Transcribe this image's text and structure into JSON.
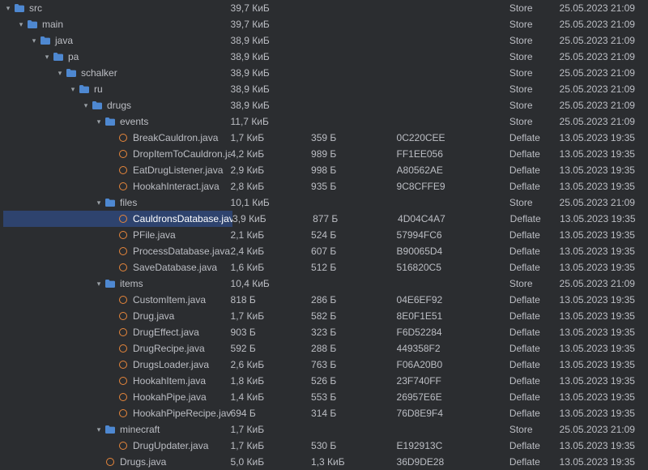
{
  "colors": {
    "background": "#2b2d30",
    "text": "#bcbec4",
    "selection": "#2e436e",
    "folder": "#4e88d1",
    "file_ring": "#e8873b"
  },
  "rows": [
    {
      "indent": 0,
      "expanded": true,
      "kind": "folder",
      "selected": false,
      "name": "src",
      "size": "39,7 КиБ",
      "packed": "",
      "crc": "",
      "method": "Store",
      "date": "25.05.2023 21:09"
    },
    {
      "indent": 1,
      "expanded": true,
      "kind": "folder",
      "selected": false,
      "name": "main",
      "size": "39,7 КиБ",
      "packed": "",
      "crc": "",
      "method": "Store",
      "date": "25.05.2023 21:09"
    },
    {
      "indent": 2,
      "expanded": true,
      "kind": "folder",
      "selected": false,
      "name": "java",
      "size": "38,9 КиБ",
      "packed": "",
      "crc": "",
      "method": "Store",
      "date": "25.05.2023 21:09"
    },
    {
      "indent": 3,
      "expanded": true,
      "kind": "folder",
      "selected": false,
      "name": "pa",
      "size": "38,9 КиБ",
      "packed": "",
      "crc": "",
      "method": "Store",
      "date": "25.05.2023 21:09"
    },
    {
      "indent": 4,
      "expanded": true,
      "kind": "folder",
      "selected": false,
      "name": "schalker",
      "size": "38,9 КиБ",
      "packed": "",
      "crc": "",
      "method": "Store",
      "date": "25.05.2023 21:09"
    },
    {
      "indent": 5,
      "expanded": true,
      "kind": "folder",
      "selected": false,
      "name": "ru",
      "size": "38,9 КиБ",
      "packed": "",
      "crc": "",
      "method": "Store",
      "date": "25.05.2023 21:09"
    },
    {
      "indent": 6,
      "expanded": true,
      "kind": "folder",
      "selected": false,
      "name": "drugs",
      "size": "38,9 КиБ",
      "packed": "",
      "crc": "",
      "method": "Store",
      "date": "25.05.2023 21:09"
    },
    {
      "indent": 7,
      "expanded": true,
      "kind": "folder",
      "selected": false,
      "name": "events",
      "size": "11,7 КиБ",
      "packed": "",
      "crc": "",
      "method": "Store",
      "date": "25.05.2023 21:09"
    },
    {
      "indent": 8,
      "expanded": null,
      "kind": "file",
      "selected": false,
      "name": "BreakCauldron.java",
      "size": "1,7 КиБ",
      "packed": "359 Б",
      "crc": "0C220CEE",
      "method": "Deflate",
      "date": "13.05.2023 19:35"
    },
    {
      "indent": 8,
      "expanded": null,
      "kind": "file",
      "selected": false,
      "name": "DropItemToCauldron.java",
      "size": "4,2 КиБ",
      "packed": "989 Б",
      "crc": "FF1EE056",
      "method": "Deflate",
      "date": "13.05.2023 19:35"
    },
    {
      "indent": 8,
      "expanded": null,
      "kind": "file",
      "selected": false,
      "name": "EatDrugListener.java",
      "size": "2,9 КиБ",
      "packed": "998 Б",
      "crc": "A80562AE",
      "method": "Deflate",
      "date": "13.05.2023 19:35"
    },
    {
      "indent": 8,
      "expanded": null,
      "kind": "file",
      "selected": false,
      "name": "HookahInteract.java",
      "size": "2,8 КиБ",
      "packed": "935 Б",
      "crc": "9C8CFFE9",
      "method": "Deflate",
      "date": "13.05.2023 19:35"
    },
    {
      "indent": 7,
      "expanded": true,
      "kind": "folder",
      "selected": false,
      "name": "files",
      "size": "10,1 КиБ",
      "packed": "",
      "crc": "",
      "method": "Store",
      "date": "25.05.2023 21:09"
    },
    {
      "indent": 8,
      "expanded": null,
      "kind": "file",
      "selected": true,
      "name": "CauldronsDatabase.java",
      "size": "3,9 КиБ",
      "packed": "877 Б",
      "crc": "4D04C4A7",
      "method": "Deflate",
      "date": "13.05.2023 19:35"
    },
    {
      "indent": 8,
      "expanded": null,
      "kind": "file",
      "selected": false,
      "name": "PFile.java",
      "size": "2,1 КиБ",
      "packed": "524 Б",
      "crc": "57994FC6",
      "method": "Deflate",
      "date": "13.05.2023 19:35"
    },
    {
      "indent": 8,
      "expanded": null,
      "kind": "file",
      "selected": false,
      "name": "ProcessDatabase.java",
      "size": "2,4 КиБ",
      "packed": "607 Б",
      "crc": "B90065D4",
      "method": "Deflate",
      "date": "13.05.2023 19:35"
    },
    {
      "indent": 8,
      "expanded": null,
      "kind": "file",
      "selected": false,
      "name": "SaveDatabase.java",
      "size": "1,6 КиБ",
      "packed": "512 Б",
      "crc": "516820C5",
      "method": "Deflate",
      "date": "13.05.2023 19:35"
    },
    {
      "indent": 7,
      "expanded": true,
      "kind": "folder",
      "selected": false,
      "name": "items",
      "size": "10,4 КиБ",
      "packed": "",
      "crc": "",
      "method": "Store",
      "date": "25.05.2023 21:09"
    },
    {
      "indent": 8,
      "expanded": null,
      "kind": "file",
      "selected": false,
      "name": "CustomItem.java",
      "size": "818 Б",
      "packed": "286 Б",
      "crc": "04E6EF92",
      "method": "Deflate",
      "date": "13.05.2023 19:35"
    },
    {
      "indent": 8,
      "expanded": null,
      "kind": "file",
      "selected": false,
      "name": "Drug.java",
      "size": "1,7 КиБ",
      "packed": "582 Б",
      "crc": "8E0F1E51",
      "method": "Deflate",
      "date": "13.05.2023 19:35"
    },
    {
      "indent": 8,
      "expanded": null,
      "kind": "file",
      "selected": false,
      "name": "DrugEffect.java",
      "size": "903 Б",
      "packed": "323 Б",
      "crc": "F6D52284",
      "method": "Deflate",
      "date": "13.05.2023 19:35"
    },
    {
      "indent": 8,
      "expanded": null,
      "kind": "file",
      "selected": false,
      "name": "DrugRecipe.java",
      "size": "592 Б",
      "packed": "288 Б",
      "crc": "449358F2",
      "method": "Deflate",
      "date": "13.05.2023 19:35"
    },
    {
      "indent": 8,
      "expanded": null,
      "kind": "file",
      "selected": false,
      "name": "DrugsLoader.java",
      "size": "2,6 КиБ",
      "packed": "763 Б",
      "crc": "F06A20B0",
      "method": "Deflate",
      "date": "13.05.2023 19:35"
    },
    {
      "indent": 8,
      "expanded": null,
      "kind": "file",
      "selected": false,
      "name": "HookahItem.java",
      "size": "1,8 КиБ",
      "packed": "526 Б",
      "crc": "23F740FF",
      "method": "Deflate",
      "date": "13.05.2023 19:35"
    },
    {
      "indent": 8,
      "expanded": null,
      "kind": "file",
      "selected": false,
      "name": "HookahPipe.java",
      "size": "1,4 КиБ",
      "packed": "553 Б",
      "crc": "26957E6E",
      "method": "Deflate",
      "date": "13.05.2023 19:35"
    },
    {
      "indent": 8,
      "expanded": null,
      "kind": "file",
      "selected": false,
      "name": "HookahPipeRecipe.java",
      "size": "694 Б",
      "packed": "314 Б",
      "crc": "76D8E9F4",
      "method": "Deflate",
      "date": "13.05.2023 19:35"
    },
    {
      "indent": 7,
      "expanded": true,
      "kind": "folder",
      "selected": false,
      "name": "minecraft",
      "size": "1,7 КиБ",
      "packed": "",
      "crc": "",
      "method": "Store",
      "date": "25.05.2023 21:09"
    },
    {
      "indent": 8,
      "expanded": null,
      "kind": "file",
      "selected": false,
      "name": "DrugUpdater.java",
      "size": "1,7 КиБ",
      "packed": "530 Б",
      "crc": "E192913C",
      "method": "Deflate",
      "date": "13.05.2023 19:35"
    },
    {
      "indent": 7,
      "expanded": null,
      "kind": "file",
      "selected": false,
      "name": "Drugs.java",
      "size": "5,0 КиБ",
      "packed": "1,3 КиБ",
      "crc": "36D9DE28",
      "method": "Deflate",
      "date": "13.05.2023 19:35"
    }
  ]
}
